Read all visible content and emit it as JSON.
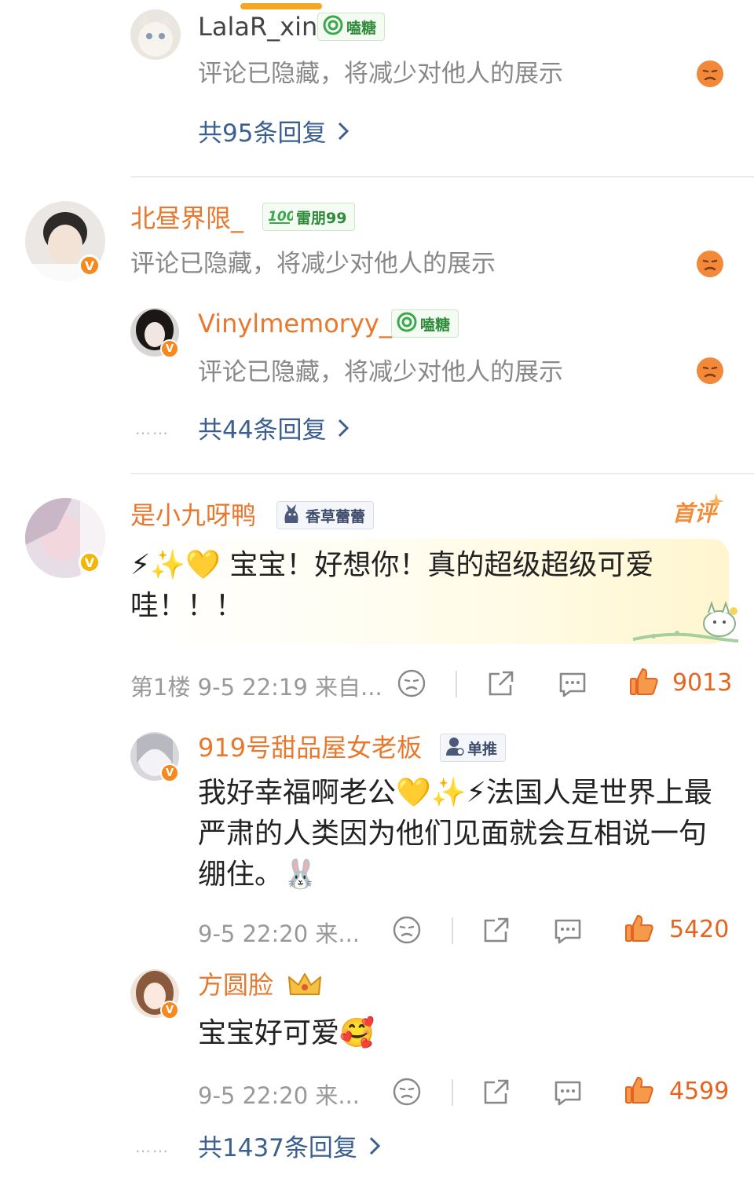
{
  "colors": {
    "accent_orange": "#e8782e",
    "link_blue": "#3b5f8f",
    "like_orange": "#e6641f",
    "muted_gray": "#999999",
    "divider": "#ececec"
  },
  "comments": [
    {
      "user": "LalaR_xin",
      "tag": "嗑糖",
      "tag_icon": "lollipop-icon",
      "text": "评论已隐藏，将减少对他人的展示",
      "emoji_icon": "sad-face-icon",
      "replies_label": "共95条回复"
    },
    {
      "user": "北昼界限_",
      "tag": "雷朋99",
      "tag_icon": "hundred-icon",
      "verified": "V",
      "text": "评论已隐藏，将减少对他人的展示",
      "emoji_icon": "sad-face-icon",
      "reply": {
        "user": "Vinylmemoryy_",
        "tag": "嗑糖",
        "tag_icon": "lollipop-icon",
        "verified": "V",
        "text": "评论已隐藏，将减少对他人的展示"
      },
      "replies_dots": "……",
      "replies_label": "共44条回复"
    },
    {
      "user": "是小九呀鸭",
      "tag": "香草蕾蕾",
      "tag_icon": "cat-icon",
      "verified": "V",
      "badge": "首评",
      "text": "⚡✨💛 宝宝！好想你！真的超级超级可爱哇！！！",
      "meta": "第1楼  9-5 22:19  来自...",
      "likes": "9013",
      "replies": [
        {
          "user": "919号甜品屋女老板",
          "tag": "单推",
          "tag_icon": "person-icon",
          "verified": "V",
          "text": "我好幸福啊老公💛✨⚡法国人是世界上最严肃的人类因为他们见面就会互相说一句绷住。🐰",
          "meta": "9-5 22:20  来...",
          "likes": "5420"
        },
        {
          "user": "方圆脸",
          "verified": "V",
          "badge_icon": "crown-icon",
          "text": "宝宝好可爱🥰",
          "meta": "9-5 22:20  来...",
          "likes": "4599"
        }
      ],
      "replies_dots": "……",
      "replies_label": "共1437条回复"
    }
  ]
}
